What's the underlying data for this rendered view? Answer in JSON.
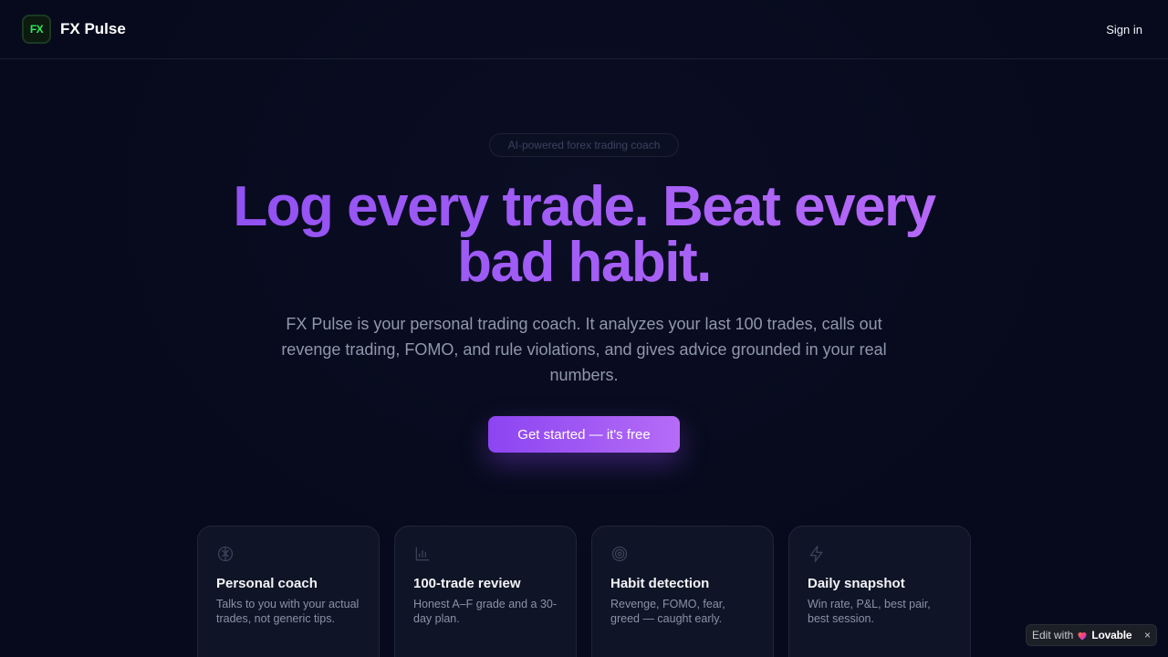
{
  "header": {
    "logo_text": "FX",
    "brand_name": "FX Pulse",
    "signin_label": "Sign in"
  },
  "hero": {
    "pill": "AI-powered forex trading coach",
    "headline_line1": "Log every trade. Beat every",
    "headline_line2": "bad habit.",
    "subtext": "FX Pulse is your personal trading coach. It analyzes your last 100 trades, calls out revenge trading, FOMO, and rule violations, and gives advice grounded in your real numbers.",
    "cta_label": "Get started — it's free"
  },
  "features": [
    {
      "icon": "brain-icon",
      "title": "Personal coach",
      "desc": "Talks to you with your actual trades, not generic tips."
    },
    {
      "icon": "bar-chart-icon",
      "title": "100-trade review",
      "desc": "Honest A–F grade and a 30-day plan."
    },
    {
      "icon": "target-icon",
      "title": "Habit detection",
      "desc": "Revenge, FOMO, fear, greed — caught early."
    },
    {
      "icon": "lightning-icon",
      "title": "Daily snapshot",
      "desc": "Win rate, P&L, best pair, best session."
    }
  ],
  "badge": {
    "prefix": "Edit with",
    "brand": "Lovable",
    "close": "×"
  },
  "colors": {
    "background": "#070a1c",
    "accent_start": "#8c45f1",
    "accent_end": "#b56cf6",
    "logo_green": "#2ee65a"
  }
}
